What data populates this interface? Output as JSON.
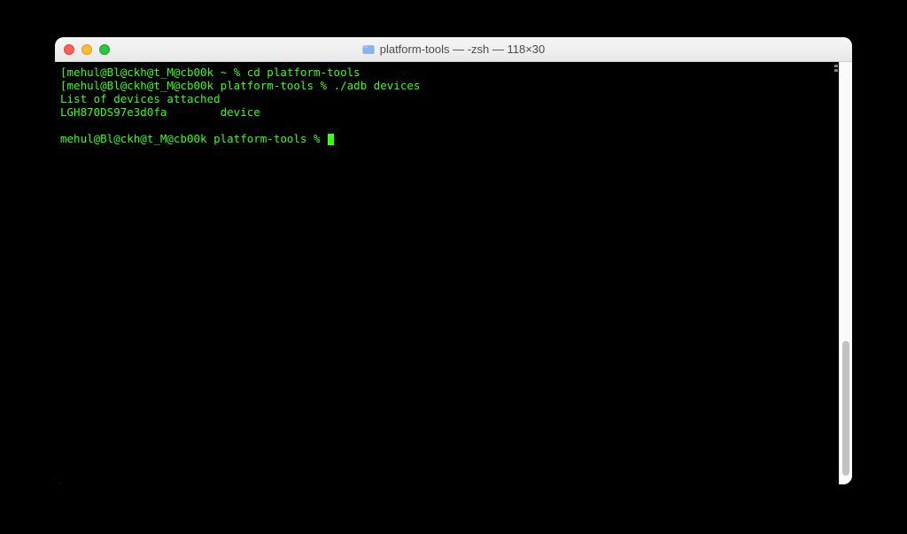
{
  "window": {
    "title": "platform-tools — -zsh — 118×30",
    "title_icon": "folder-icon"
  },
  "terminal": {
    "lines": [
      {
        "prompt": "[mehul@Bl@ckh@t_M@cb00k ~ % ",
        "cmd": "cd platform-tools"
      },
      {
        "prompt": "[mehul@Bl@ckh@t_M@cb00k platform-tools % ",
        "cmd": "./adb devices"
      },
      {
        "text": "List of devices attached"
      },
      {
        "text": "LGH870DS97e3d0fa        device"
      },
      {
        "blank": true
      },
      {
        "prompt": "mehul@Bl@ckh@t_M@cb00k platform-tools % ",
        "cursor": true
      }
    ]
  }
}
